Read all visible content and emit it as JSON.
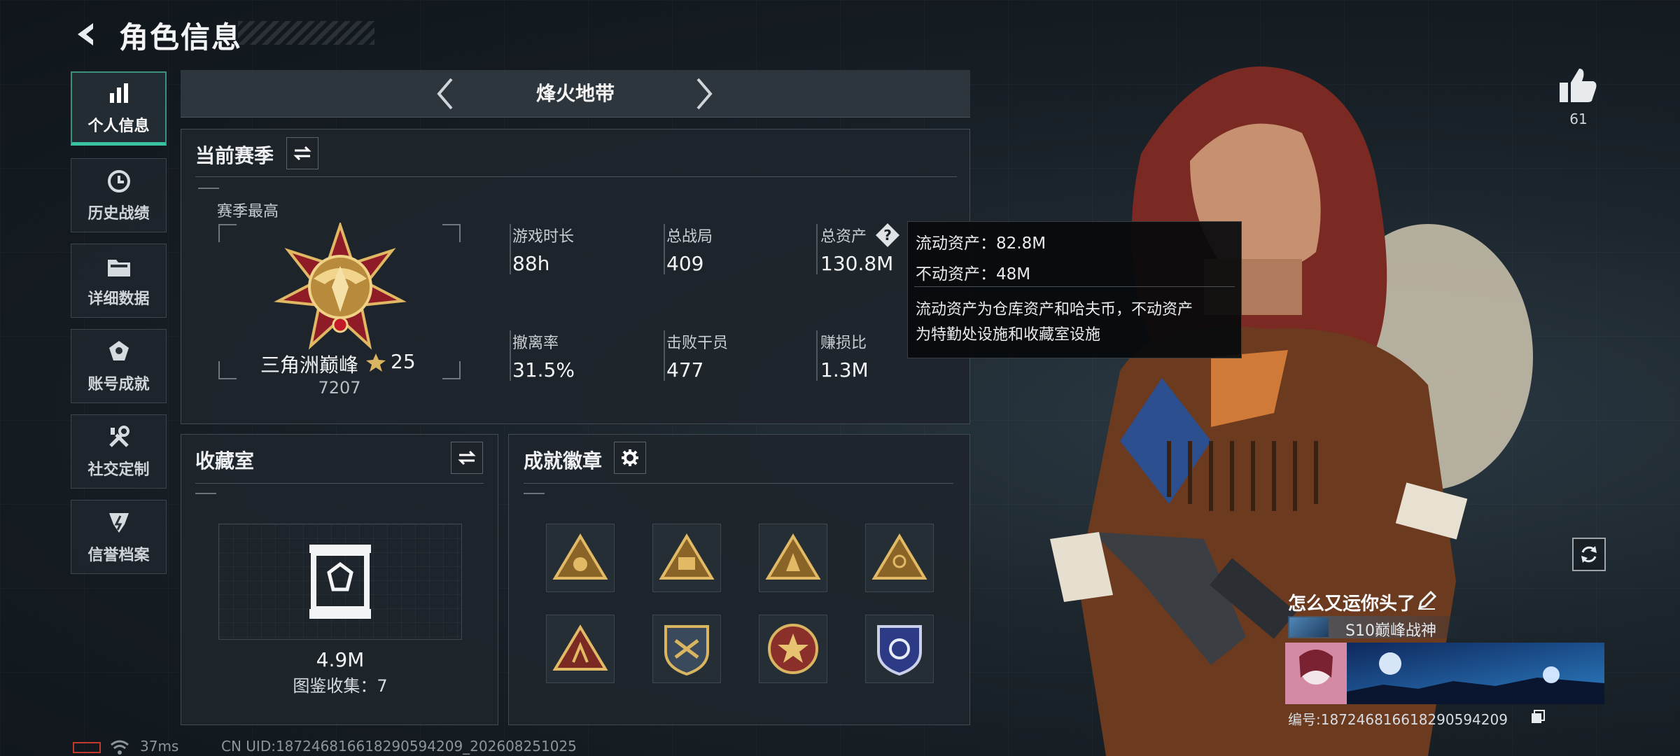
{
  "header": {
    "title": "角色信息"
  },
  "sidebar": {
    "items": [
      {
        "label": "个人信息",
        "icon": "bar-chart-icon",
        "active": true
      },
      {
        "label": "历史战绩",
        "icon": "history-clock-icon",
        "active": false
      },
      {
        "label": "详细数据",
        "icon": "folder-icon",
        "active": false
      },
      {
        "label": "账号成就",
        "icon": "trophy-icon",
        "active": false
      },
      {
        "label": "社交定制",
        "icon": "tools-icon",
        "active": false
      },
      {
        "label": "信誉档案",
        "icon": "shield-icon",
        "active": false
      }
    ]
  },
  "mode": {
    "title": "烽火地带"
  },
  "season": {
    "title": "当前赛季",
    "best_label": "赛季最高",
    "rank_name": "三角洲巅峰",
    "rank_stars": "25",
    "rank_score": "7207",
    "stats": [
      {
        "label": "游戏时长",
        "value": "88h"
      },
      {
        "label": "总战局",
        "value": "409"
      },
      {
        "label": "总资产",
        "value": "130.8M"
      },
      {
        "label": "撤离率",
        "value": "31.5%"
      },
      {
        "label": "击败干员",
        "value": "477"
      },
      {
        "label": "赚损比",
        "value": "1.3M"
      }
    ]
  },
  "tooltip": {
    "line1": "流动资产：82.8M",
    "line2": "不动资产：48M",
    "desc1": "流动资产为仓库资产和哈夫币，不动资产",
    "desc2": "为特勤处设施和收藏室设施"
  },
  "collection": {
    "title": "收藏室",
    "value": "4.9M",
    "atlas": "图鉴收集：7"
  },
  "badges": {
    "title": "成就徽章",
    "items": [
      "badge-1",
      "badge-2",
      "badge-3",
      "badge-4",
      "badge-5",
      "badge-6",
      "badge-7",
      "badge-8"
    ]
  },
  "profile": {
    "likes": "61",
    "name": "怎么又运你头了",
    "rank_title": "S10巅峰战神",
    "uid_label": "编号:1872468166182905942​09"
  },
  "footer": {
    "ping": "37ms",
    "uid": "CN UID:1872468166182905942​09_202608251025"
  },
  "colors": {
    "accent": "#39c2a0",
    "gold": "#d4a94c",
    "red_medal": "#b01e2c"
  }
}
